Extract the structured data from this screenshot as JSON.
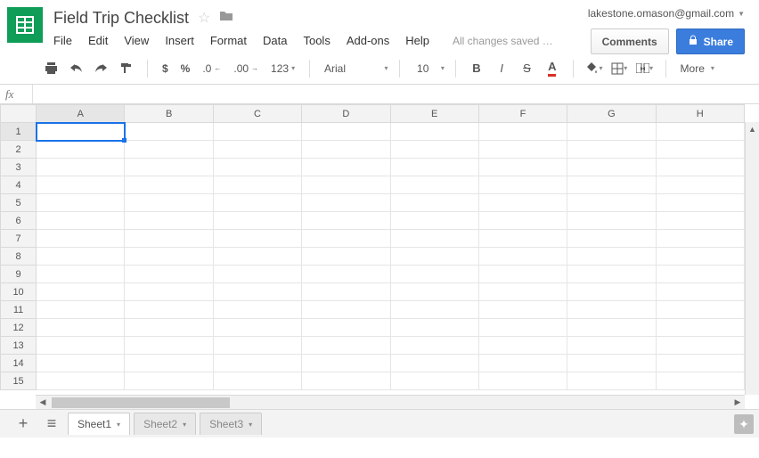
{
  "doc": {
    "title": "Field Trip Checklist"
  },
  "user": {
    "email": "lakestone.omason@gmail.com"
  },
  "menu": [
    "File",
    "Edit",
    "View",
    "Insert",
    "Format",
    "Data",
    "Tools",
    "Add-ons",
    "Help"
  ],
  "save_status": "All changes saved …",
  "buttons": {
    "comments": "Comments",
    "share": "Share"
  },
  "toolbar": {
    "currency": "$",
    "percent": "%",
    "dec_dec": ".0",
    "inc_dec": ".00",
    "num_format": "123",
    "font": "Arial",
    "size": "10",
    "bold": "B",
    "italic": "I",
    "strike": "S",
    "more": "More"
  },
  "fx": {
    "label": "fx",
    "value": ""
  },
  "columns": [
    "A",
    "B",
    "C",
    "D",
    "E",
    "F",
    "G",
    "H"
  ],
  "rows": [
    "1",
    "2",
    "3",
    "4",
    "5",
    "6",
    "7",
    "8",
    "9",
    "10",
    "11",
    "12",
    "13",
    "14",
    "15"
  ],
  "selected_cell": "A1",
  "sheets": [
    {
      "name": "Sheet1",
      "active": true
    },
    {
      "name": "Sheet2",
      "active": false
    },
    {
      "name": "Sheet3",
      "active": false
    }
  ]
}
